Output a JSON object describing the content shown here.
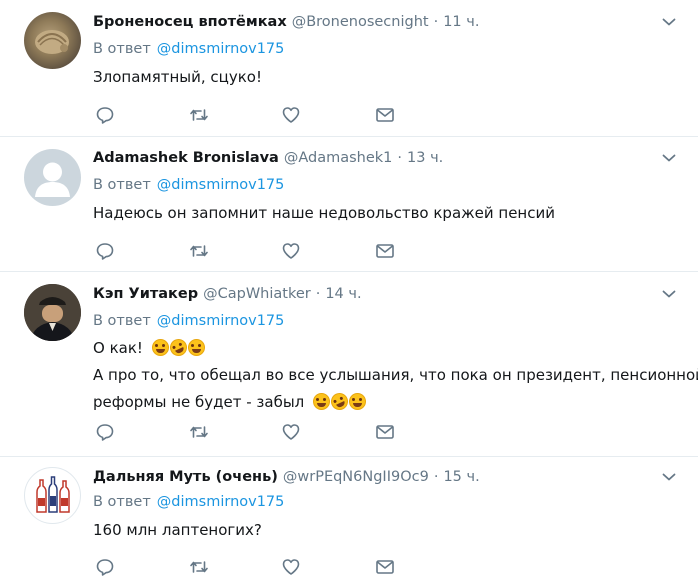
{
  "reply_prefix": "В ответ",
  "tweets": [
    {
      "name": "Броненосец впотёмках",
      "handle": "@Bronenosecnight",
      "separator": "·",
      "time": "11 ч.",
      "reply_to": "@dimsmirnov175",
      "lines": [
        "Злопамятный, сцуко!"
      ],
      "avatar": "armadillo-photo"
    },
    {
      "name": "Adamashek Bronislava",
      "handle": "@Adamashek1",
      "separator": "·",
      "time": "13 ч.",
      "reply_to": "@dimsmirnov175",
      "lines": [
        "Надеюсь он запомнит наше недовольство кражей пенсий"
      ],
      "avatar": "default-avatar"
    },
    {
      "name": "Кэп Уитакер",
      "handle": "@CapWhiatker",
      "separator": "·",
      "time": "14 ч.",
      "reply_to": "@dimsmirnov175",
      "lines": [
        "О как!",
        "А про то, что обещал во все услышания, что пока он президент, пенсионной",
        "реформы не будет - забыл"
      ],
      "avatar": "man-in-cap-photo"
    },
    {
      "name": "Дальняя Муть (очень)",
      "handle": "@wrPEqN6NgII9Oc9",
      "separator": "·",
      "time": "15 ч.",
      "reply_to": "@dimsmirnov175",
      "lines": [
        "160 млн лаптеногих?"
      ],
      "avatar": "bottles-logo"
    }
  ],
  "icons": [
    "reply-icon",
    "retweet-icon",
    "like-icon",
    "direct-message-icon",
    "chevron-down-icon",
    "tears-of-joy-emoji",
    "rofl-emoji"
  ],
  "colors": {
    "link": "#1b95e0",
    "secondary": "#657786",
    "icon": "#657786",
    "divider": "#e6ecf0",
    "text": "#14171a"
  }
}
